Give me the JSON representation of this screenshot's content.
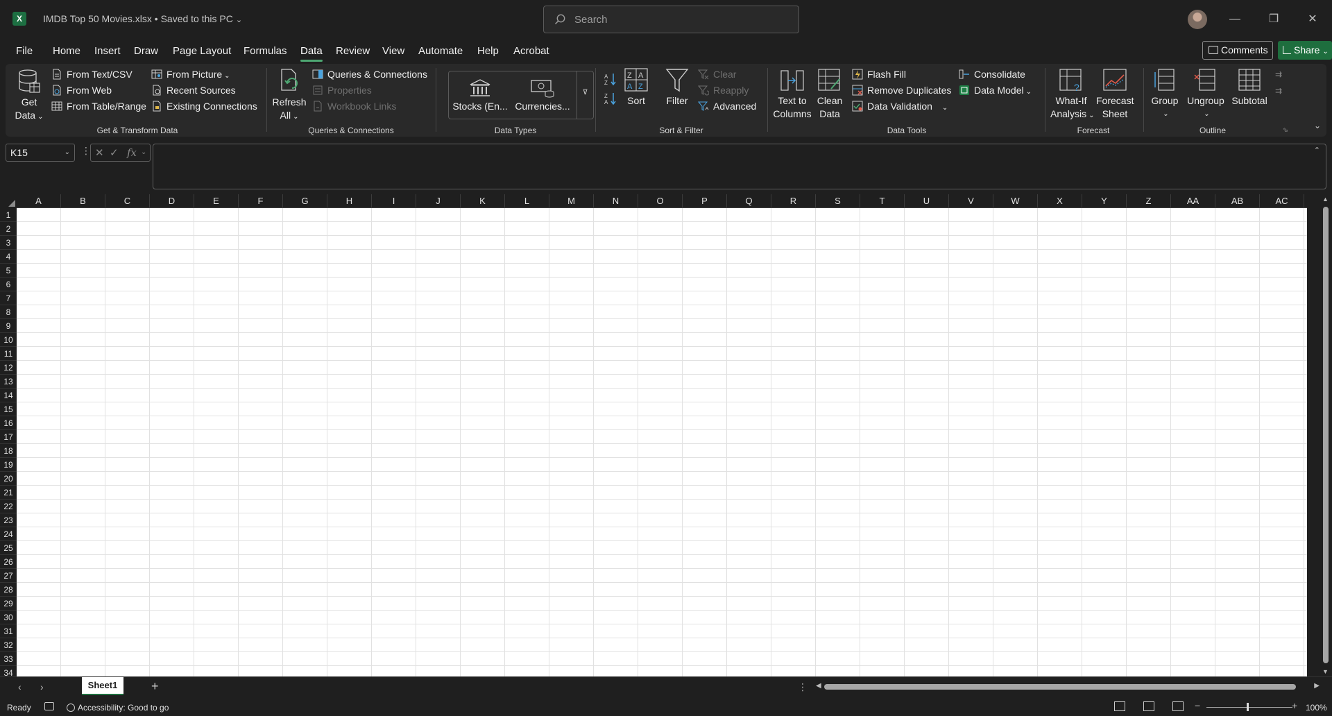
{
  "app": {
    "title": "IMDB Top 50 Movies.xlsx • Saved to this PC",
    "logo_letter": "X",
    "search_placeholder": "Search",
    "accent": "#1e6e3e"
  },
  "menu_tabs": [
    "File",
    "Home",
    "Insert",
    "Draw",
    "Page Layout",
    "Formulas",
    "Data",
    "Review",
    "View",
    "Automate",
    "Help",
    "Acrobat"
  ],
  "active_tab": "Data",
  "header_actions": {
    "comments": "Comments",
    "share": "Share"
  },
  "ribbon": {
    "get_transform": {
      "label": "Get & Transform Data",
      "get_data": [
        "Get",
        "Data"
      ],
      "from_text_csv": "From Text/CSV",
      "from_web": "From Web",
      "from_table_range": "From Table/Range",
      "from_picture": "From Picture",
      "recent_sources": "Recent Sources",
      "existing_connections": "Existing Connections"
    },
    "queries": {
      "label": "Queries & Connections",
      "refresh_all": [
        "Refresh",
        "All"
      ],
      "queries_connections": "Queries & Connections",
      "properties": "Properties",
      "workbook_links": "Workbook Links"
    },
    "data_types": {
      "label": "Data Types",
      "stocks": "Stocks (En...",
      "currencies": "Currencies..."
    },
    "sort_filter": {
      "label": "Sort & Filter",
      "sort": "Sort",
      "filter": "Filter",
      "clear": "Clear",
      "reapply": "Reapply",
      "advanced": "Advanced"
    },
    "data_tools": {
      "label": "Data Tools",
      "text_to_columns": [
        "Text to",
        "Columns"
      ],
      "clean_data": [
        "Clean",
        "Data"
      ],
      "flash_fill": "Flash Fill",
      "remove_duplicates": "Remove Duplicates",
      "data_validation": "Data Validation",
      "consolidate": "Consolidate",
      "data_model": "Data Model"
    },
    "forecast": {
      "label": "Forecast",
      "what_if": [
        "What-If",
        "Analysis"
      ],
      "forecast_sheet": [
        "Forecast",
        "Sheet"
      ]
    },
    "outline": {
      "label": "Outline",
      "group": "Group",
      "ungroup": "Ungroup",
      "subtotal": "Subtotal"
    }
  },
  "formula_bar": {
    "name_box": "K15",
    "fx": "fx",
    "value": ""
  },
  "columns": [
    "A",
    "B",
    "C",
    "D",
    "E",
    "F",
    "G",
    "H",
    "I",
    "J",
    "K",
    "L",
    "M",
    "N",
    "O",
    "P",
    "Q",
    "R",
    "S",
    "T",
    "U",
    "V",
    "W",
    "X",
    "Y",
    "Z",
    "AA",
    "AB",
    "AC"
  ],
  "rows": [
    "1",
    "2",
    "3",
    "4",
    "5",
    "6",
    "7",
    "8",
    "9",
    "10",
    "11",
    "12",
    "13",
    "14",
    "15",
    "16",
    "17",
    "18",
    "19",
    "20",
    "21",
    "22",
    "23",
    "24",
    "25",
    "26",
    "27",
    "28",
    "29",
    "30",
    "31",
    "32",
    "33",
    "34"
  ],
  "sheets": [
    "Sheet1"
  ],
  "status": {
    "ready": "Ready",
    "accessibility": "Accessibility: Good to go",
    "zoom": "100%"
  }
}
